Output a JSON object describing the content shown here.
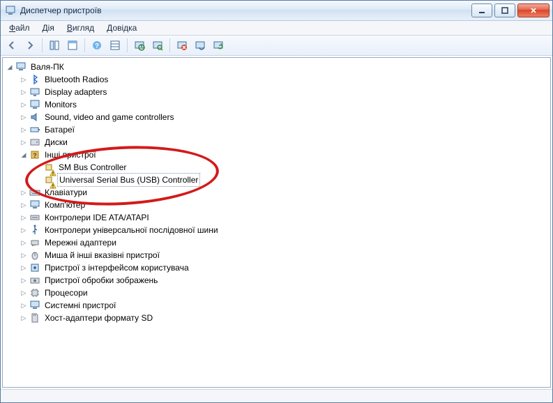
{
  "window": {
    "title": "Диспетчер пристроїв"
  },
  "menu": {
    "file": "Файл",
    "action": "Дія",
    "view": "Вигляд",
    "help": "Довідка",
    "file_accel": "Ф",
    "action_accel": "Д",
    "view_accel": "В",
    "help_accel": "Д"
  },
  "tree": {
    "root": "Валя-ПК",
    "items": [
      "Bluetooth Radios",
      "Display adapters",
      "Monitors",
      "Sound, video and game controllers",
      "Батареї",
      "Диски",
      "Інші пристрої",
      "Клавіатури",
      "Комп'ютер",
      "Контролери IDE ATA/ATAPI",
      "Контролери універсальної послідовної шини",
      "Мережні адаптери",
      "Миша й інші вказівні пристрої",
      "Пристрої з інтерфейсом користувача",
      "Пристрої обробки зображень",
      "Процесори",
      "Системні пристрої",
      "Хост-адаптери формату SD"
    ],
    "other_children": [
      "SM Bus Controller",
      "Universal Serial Bus (USB) Controller"
    ]
  }
}
